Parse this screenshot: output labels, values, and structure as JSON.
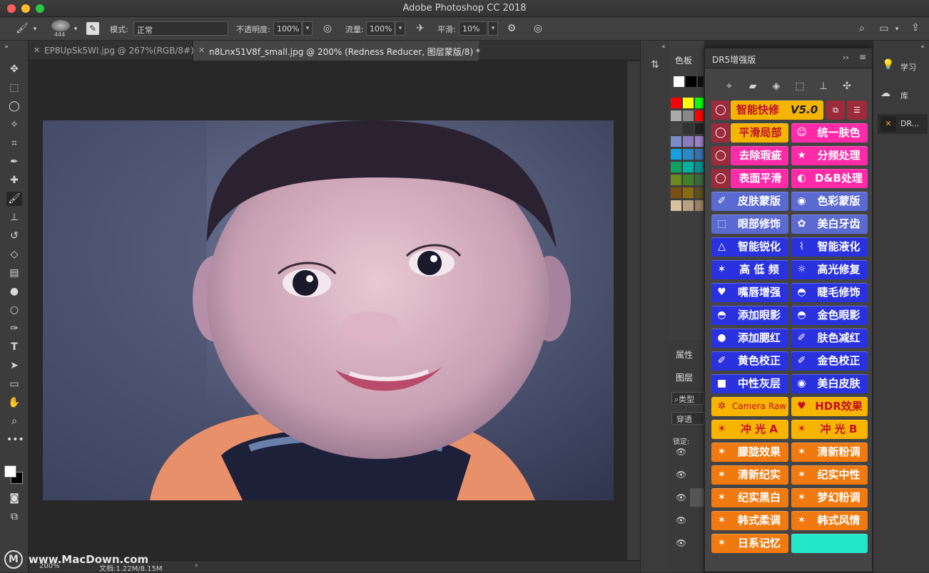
{
  "window": {
    "title": "Adobe Photoshop CC 2018"
  },
  "options": {
    "brush_size": "444",
    "mode_label": "模式:",
    "mode_value": "正常",
    "opacity_label": "不透明度:",
    "opacity_value": "100%",
    "flow_label": "流量:",
    "flow_value": "100%",
    "smooth_label": "平滑:",
    "smooth_value": "10%"
  },
  "tabs": [
    {
      "label": "EP8UpSk5WI.jpg @ 267%(RGB/8#)"
    },
    {
      "label": "n8Lnx51V8f_small.jpg @ 200% (Redness Reducer, 图层蒙版/8) *"
    }
  ],
  "status": {
    "zoom": "200%",
    "doc": "文档:1.22M/8.15M",
    "watermark": "www.MacDown.com"
  },
  "swatches_panel": {
    "title": "色板"
  },
  "lower_panel": {
    "properties": "属性",
    "layers": "图层",
    "kind": "类型",
    "blend": "穿透",
    "lock": "锁定:"
  },
  "dr5": {
    "title": "DR5增强版",
    "version": "V5.0",
    "buttons": [
      {
        "label": "智能快修"
      },
      {
        "label": "平滑局部"
      },
      {
        "label": "统一肤色"
      },
      {
        "label": "去除瑕疵"
      },
      {
        "label": "分频处理"
      },
      {
        "label": "表面平滑"
      },
      {
        "label": "D&B处理"
      },
      {
        "label": "皮肤蒙版"
      },
      {
        "label": "色彩蒙版"
      },
      {
        "label": "眼部修饰"
      },
      {
        "label": "美白牙齿"
      },
      {
        "label": "智能锐化"
      },
      {
        "label": "智能液化"
      },
      {
        "label": "高 低 频"
      },
      {
        "label": "高光修复"
      },
      {
        "label": "嘴唇增强"
      },
      {
        "label": "睫毛修饰"
      },
      {
        "label": "添加眼影"
      },
      {
        "label": "金色眼影"
      },
      {
        "label": "添加腮红"
      },
      {
        "label": "肤色减红"
      },
      {
        "label": "黄色校正"
      },
      {
        "label": "金色校正"
      },
      {
        "label": "中性灰层"
      },
      {
        "label": "美白皮肤"
      },
      {
        "label": "Camera Raw"
      },
      {
        "label": "HDR效果"
      },
      {
        "label": "冲 光 A"
      },
      {
        "label": "冲 光 B"
      },
      {
        "label": "朦胧效果"
      },
      {
        "label": "清新粉调"
      },
      {
        "label": "清新纪实"
      },
      {
        "label": "纪实中性"
      },
      {
        "label": "纪实黑白"
      },
      {
        "label": "梦幻粉调"
      },
      {
        "label": "韩式柔调"
      },
      {
        "label": "韩式风情"
      },
      {
        "label": "日系记忆"
      },
      {
        "label": ""
      }
    ]
  },
  "right_panel": {
    "learn": "学习",
    "library": "库",
    "dr": "DR..."
  },
  "colors": {
    "orange": "#f07a10",
    "blue": "#2a32e0",
    "pink": "#ff2aa8",
    "yellow": "#f7b500",
    "cyan": "#22e6c8"
  }
}
